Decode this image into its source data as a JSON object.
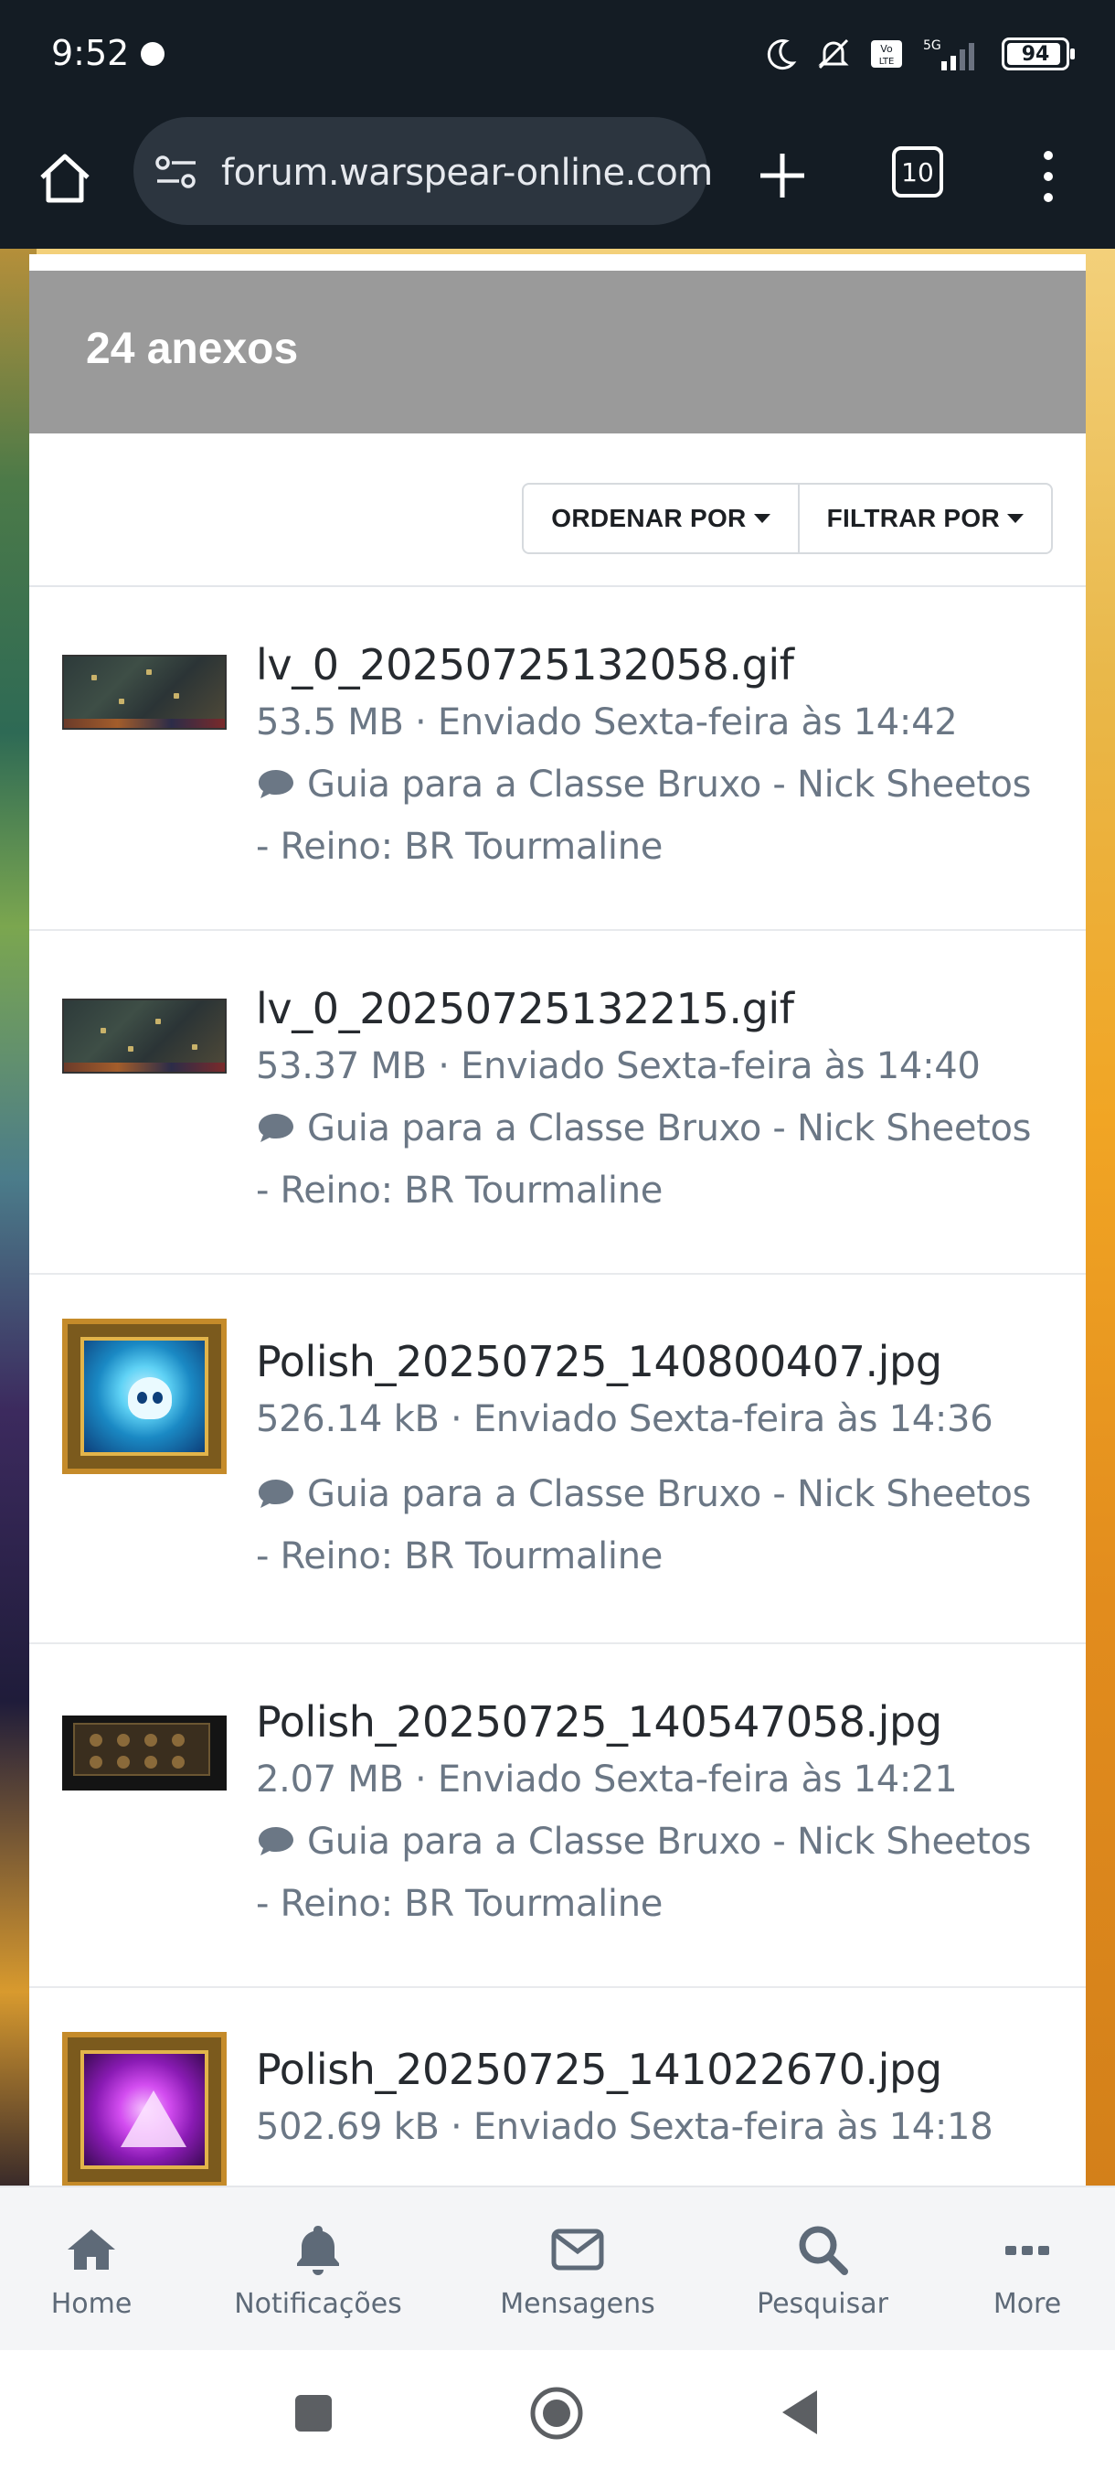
{
  "status_bar": {
    "time": "9:52",
    "battery": "94",
    "battery_level_pct": 94,
    "icons": [
      "whatsapp-icon",
      "moon-icon",
      "mute-icon",
      "volte-icon",
      "signal-5g-icon"
    ]
  },
  "browser": {
    "url": "forum.warspear-online.com",
    "tab_count": "10"
  },
  "panel": {
    "title": "24 anexos",
    "sort_label": "ORDENAR POR",
    "filter_label": "FILTRAR POR"
  },
  "attachments": [
    {
      "name": "lv_0_20250725132058.gif",
      "meta": "53.5 MB · Enviado Sexta-feira às 14:42",
      "topic": "Guia para a Classe Bruxo - Nick Sheetos - Reino: BR Tourmaline",
      "thumb": "gif"
    },
    {
      "name": "lv_0_20250725132215.gif",
      "meta": "53.37 MB · Enviado Sexta-feira às 14:40",
      "topic": "Guia para a Classe Bruxo - Nick Sheetos - Reino: BR Tourmaline",
      "thumb": "gif"
    },
    {
      "name": "Polish_20250725_140800407.jpg",
      "meta": "526.14 kB · Enviado Sexta-feira às 14:36",
      "topic": "Guia para a Classe Bruxo - Nick Sheetos - Reino: BR Tourmaline",
      "thumb": "skull-icon"
    },
    {
      "name": "Polish_20250725_140547058.jpg",
      "meta": "2.07 MB · Enviado Sexta-feira às 14:21",
      "topic": "Guia para a Classe Bruxo - Nick Sheetos - Reino: BR Tourmaline",
      "thumb": "grid"
    },
    {
      "name": "Polish_20250725_141022670.jpg",
      "meta": "502.69 kB · Enviado Sexta-feira às 14:18",
      "thumb": "purple-icon"
    }
  ],
  "bottom_nav": [
    {
      "label": "Home",
      "icon": "home-icon"
    },
    {
      "label": "Notificações",
      "icon": "bell-icon"
    },
    {
      "label": "Mensagens",
      "icon": "envelope-icon"
    },
    {
      "label": "Pesquisar",
      "icon": "search-icon"
    },
    {
      "label": "More",
      "icon": "more-icon"
    }
  ],
  "colors": {
    "panel_header": "#9a9a9a",
    "meta_text": "#6b7785",
    "nav_icon": "#5e6a78"
  }
}
